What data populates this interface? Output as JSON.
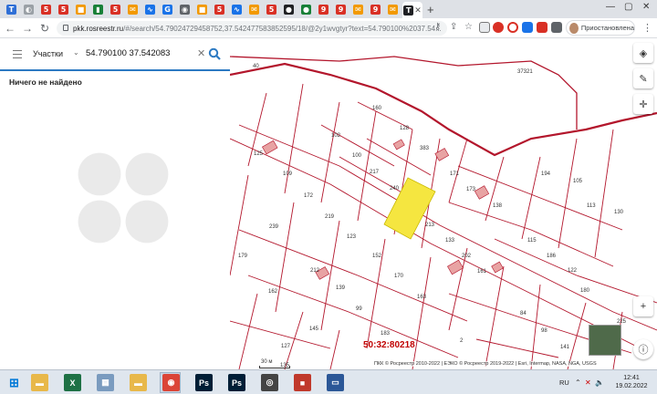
{
  "browser": {
    "url_host": "pkk.rosreestr.ru",
    "url_rest": "/#/search/54.79024729458752,37.542477583852595/18/@2y1wvgtyr?text=54.790100%2037.54...",
    "profile_label": "Приостановлена",
    "tab_favicons": [
      {
        "color": "#2f6fd6",
        "glyph": "T"
      },
      {
        "color": "#9aa0a6",
        "glyph": "◐"
      },
      {
        "color": "#d93025",
        "glyph": "5"
      },
      {
        "color": "#d93025",
        "glyph": "5"
      },
      {
        "color": "#f29900",
        "glyph": "■"
      },
      {
        "color": "#188038",
        "glyph": "▮"
      },
      {
        "color": "#d93025",
        "glyph": "5"
      },
      {
        "color": "#f29900",
        "glyph": "✉"
      },
      {
        "color": "#1a73e8",
        "glyph": "∿"
      },
      {
        "color": "#1a73e8",
        "glyph": "G"
      },
      {
        "color": "#5f6368",
        "glyph": "◉"
      },
      {
        "color": "#f29900",
        "glyph": "■"
      },
      {
        "color": "#d93025",
        "glyph": "5"
      },
      {
        "color": "#1a73e8",
        "glyph": "∿"
      },
      {
        "color": "#f29900",
        "glyph": "✉"
      },
      {
        "color": "#d93025",
        "glyph": "5"
      },
      {
        "color": "#202124",
        "glyph": "●"
      },
      {
        "color": "#188038",
        "glyph": "●"
      },
      {
        "color": "#d93025",
        "glyph": "9"
      },
      {
        "color": "#d93025",
        "glyph": "9"
      },
      {
        "color": "#f29900",
        "glyph": "✉"
      },
      {
        "color": "#d93025",
        "glyph": "9"
      },
      {
        "color": "#f29900",
        "glyph": "✉"
      },
      {
        "color": "#202124",
        "glyph": "T"
      }
    ]
  },
  "sidebar": {
    "category": "Участки",
    "query": "54.790100 37.542083",
    "result_message": "Ничего не найдено"
  },
  "map": {
    "cadastral_number": "50:32:80218",
    "scale_label": "30 м",
    "attribution": "ПКК © Росреестр 2010-2022 | ЕЭКО © Росреестр 2019-2022 | Esri, Intermap, NASA, NGA, USGS",
    "parcels": [
      "160",
      "128",
      "383",
      "102",
      "100",
      "217",
      "171",
      "194",
      "105",
      "125",
      "109",
      "240",
      "173",
      "138",
      "113",
      "130",
      "172",
      "219",
      "213",
      "239",
      "123",
      "133",
      "115",
      "179",
      "212",
      "152",
      "202",
      "186",
      "122",
      "170",
      "161",
      "139",
      "162",
      "99",
      "163",
      "84",
      "180",
      "145",
      "183",
      "98",
      "127",
      "2",
      "141",
      "135",
      "37321",
      "40",
      "225"
    ],
    "highlight_color": "#f5e640",
    "boundary_color": "#b3162c"
  },
  "taskbar": {
    "apps": [
      {
        "name": "explorer",
        "color": "#e8b84a",
        "glyph": "▬"
      },
      {
        "name": "excel",
        "color": "#1e7145",
        "glyph": "X"
      },
      {
        "name": "files",
        "color": "#7a9bbf",
        "glyph": "▦"
      },
      {
        "name": "folder",
        "color": "#e8b84a",
        "glyph": "▬"
      },
      {
        "name": "chrome",
        "color": "#db4437",
        "glyph": "◉"
      },
      {
        "name": "photoshop",
        "color": "#001e36",
        "glyph": "Ps"
      },
      {
        "name": "photoshop-2",
        "color": "#001e36",
        "glyph": "Ps"
      },
      {
        "name": "app-circle",
        "color": "#444444",
        "glyph": "◎"
      },
      {
        "name": "app-red",
        "color": "#c0392b",
        "glyph": "■"
      },
      {
        "name": "app-blue",
        "color": "#2b5797",
        "glyph": "▭"
      }
    ],
    "language": "RU",
    "time": "12:41",
    "date": "19.02.2022"
  }
}
